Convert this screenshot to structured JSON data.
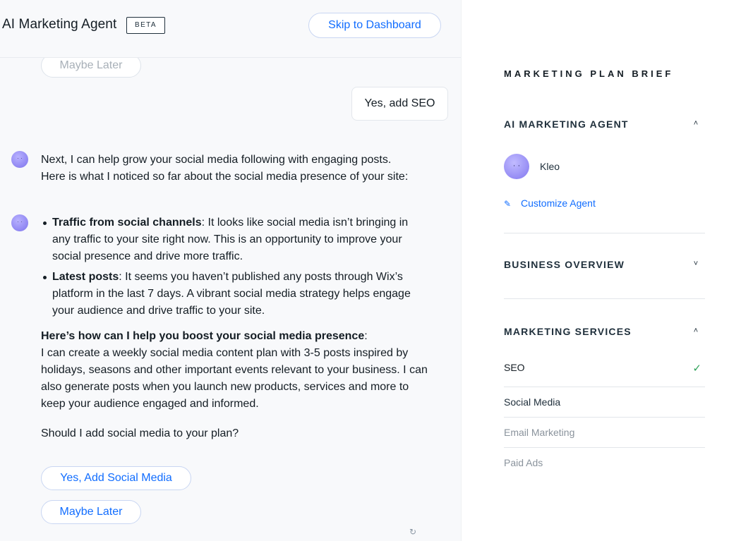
{
  "header": {
    "title": "AI Marketing Agent",
    "badge": "BETA",
    "skip_button": "Skip to Dashboard"
  },
  "chat": {
    "prev_quick_reply": "Maybe Later",
    "user_reply": "Yes, add SEO",
    "intro_line1": "Next, I can help grow your social media following with engaging posts.",
    "intro_line2": "Here is what I noticed so far about the social media presence of your site:",
    "bullets": [
      {
        "title": "Traffic from social channels",
        "text": ": It looks like social media isn’t bringing in any traffic to your site right now. This is an opportunity to improve your social presence and drive more traffic."
      },
      {
        "title": "Latest posts",
        "text": ": It seems you haven’t published any posts through Wix’s platform in the last 7 days. A vibrant social media strategy helps engage your audience and drive traffic to your site."
      }
    ],
    "help_heading": "Here’s how can I help you boost your social media presence",
    "help_heading_suffix": ":",
    "help_body": "I can create a weekly social media content plan with 3-5 posts inspired by holidays, seasons and other important events relevant to your business. I can also generate posts when you launch new products, services and more to keep your audience engaged and informed.",
    "question": "Should I add social media to your plan?",
    "quick_replies": [
      "Yes, Add Social Media",
      "Maybe Later"
    ],
    "agent_avatar_face": "· ·"
  },
  "brief": {
    "title": "MARKETING PLAN BRIEF",
    "agent_section": {
      "label": "AI MARKETING AGENT",
      "chevron": "chevron-up-icon",
      "agent_name": "Kleo",
      "customize_label": "Customize Agent"
    },
    "business_section": {
      "label": "BUSINESS OVERVIEW",
      "chevron": "chevron-down-icon"
    },
    "services_section": {
      "label": "MARKETING SERVICES",
      "chevron": "chevron-up-icon",
      "items": [
        {
          "name": "SEO",
          "status": "added",
          "color": "#141d24"
        },
        {
          "name": "Social Media",
          "status": "pending",
          "color": "#20303c"
        },
        {
          "name": "Email Marketing",
          "status": "inactive",
          "color": "#8a939c"
        },
        {
          "name": "Paid Ads",
          "status": "inactive",
          "color": "#8a939c"
        }
      ]
    }
  },
  "colors": {
    "accent": "#116dff",
    "check": "#2fa35a",
    "avatar": "#8f86f2"
  }
}
